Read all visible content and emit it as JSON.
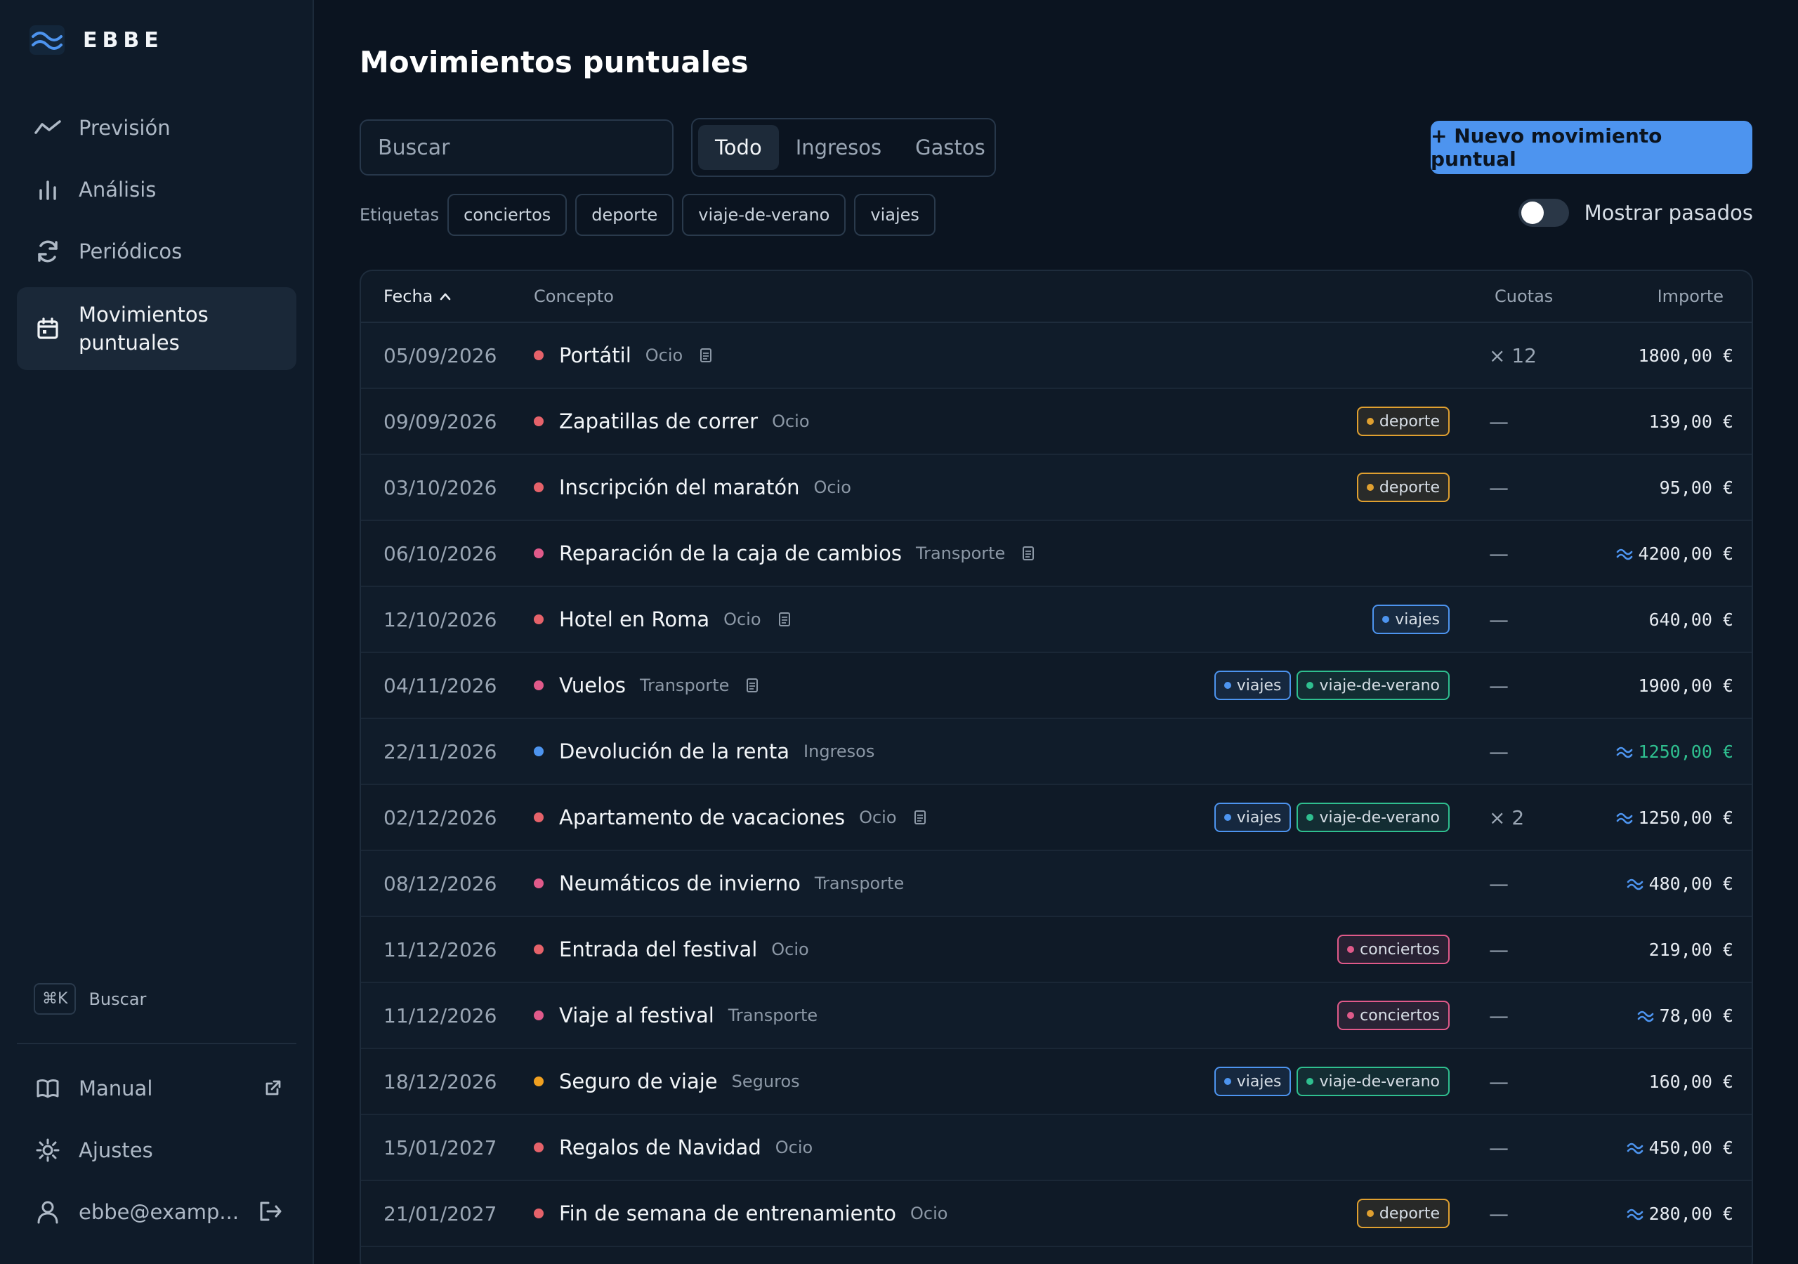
{
  "app": {
    "name": "EBBE"
  },
  "sidebar": {
    "nav": [
      {
        "label": "Previsión",
        "icon": "trend-icon"
      },
      {
        "label": "Análisis",
        "icon": "bar-chart-icon"
      },
      {
        "label": "Periódicos",
        "icon": "refresh-icon"
      },
      {
        "label": "Movimientos puntuales",
        "icon": "calendar-icon",
        "active": true
      }
    ],
    "shortcut": {
      "key": "⌘K",
      "label": "Buscar"
    },
    "bottom": [
      {
        "label": "Manual",
        "icon": "book-icon"
      },
      {
        "label": "Ajustes",
        "icon": "sun-icon"
      },
      {
        "label": "ebbe@examp...",
        "icon": "user-icon"
      }
    ]
  },
  "page": {
    "title": "Movimientos puntuales"
  },
  "toolbar": {
    "search_placeholder": "Buscar",
    "filters": [
      "Todo",
      "Ingresos",
      "Gastos"
    ],
    "active_filter": "Todo",
    "new_button": "+ Nuevo movimiento puntual",
    "tags_label": "Etiquetas",
    "tags": [
      "conciertos",
      "deporte",
      "viaje-de-verano",
      "viajes"
    ],
    "toggle_label": "Mostrar pasados",
    "toggle_on": false
  },
  "colors": {
    "accent": "#4d94ef",
    "expense_dot": "#e5626a",
    "transport_dot": "#e05a8a",
    "income_dot": "#4d94ef",
    "insurance_dot": "#f0a020",
    "income_text": "#2fbf8f",
    "tag_deporte": "#e0a030",
    "tag_viajes": "#4d94ef",
    "tag_viaje_de_verano": "#2fbf8f",
    "tag_conciertos": "#e05a8a"
  },
  "table": {
    "headers": {
      "fecha": "Fecha",
      "concepto": "Concepto",
      "cuotas": "Cuotas",
      "importe": "Importe"
    },
    "rows": [
      {
        "date": "05/09/2026",
        "name": "Portátil",
        "category": "Ocio",
        "dot": "#e5626a",
        "note": true,
        "tags": [],
        "cuotas": "× 12",
        "amount": "1800,00 €",
        "estimated": false,
        "income": false
      },
      {
        "date": "09/09/2026",
        "name": "Zapatillas de correr",
        "category": "Ocio",
        "dot": "#e5626a",
        "note": false,
        "tags": [
          "deporte"
        ],
        "cuotas": "—",
        "amount": "139,00 €",
        "estimated": false,
        "income": false
      },
      {
        "date": "03/10/2026",
        "name": "Inscripción del maratón",
        "category": "Ocio",
        "dot": "#e5626a",
        "note": false,
        "tags": [
          "deporte"
        ],
        "cuotas": "—",
        "amount": "95,00 €",
        "estimated": false,
        "income": false
      },
      {
        "date": "06/10/2026",
        "name": "Reparación de la caja de cambios",
        "category": "Transporte",
        "dot": "#e05a8a",
        "note": true,
        "tags": [],
        "cuotas": "—",
        "amount": "4200,00 €",
        "estimated": true,
        "income": false
      },
      {
        "date": "12/10/2026",
        "name": "Hotel en Roma",
        "category": "Ocio",
        "dot": "#e5626a",
        "note": true,
        "tags": [
          "viajes"
        ],
        "cuotas": "—",
        "amount": "640,00 €",
        "estimated": false,
        "income": false
      },
      {
        "date": "04/11/2026",
        "name": "Vuelos",
        "category": "Transporte",
        "dot": "#e05a8a",
        "note": true,
        "tags": [
          "viajes",
          "viaje-de-verano"
        ],
        "cuotas": "—",
        "amount": "1900,00 €",
        "estimated": false,
        "income": false
      },
      {
        "date": "22/11/2026",
        "name": "Devolución de la renta",
        "category": "Ingresos",
        "dot": "#4d94ef",
        "note": false,
        "tags": [],
        "cuotas": "—",
        "amount": "1250,00 €",
        "estimated": true,
        "income": true
      },
      {
        "date": "02/12/2026",
        "name": "Apartamento de vacaciones",
        "category": "Ocio",
        "dot": "#e5626a",
        "note": true,
        "tags": [
          "viajes",
          "viaje-de-verano"
        ],
        "cuotas": "× 2",
        "amount": "1250,00 €",
        "estimated": true,
        "income": false
      },
      {
        "date": "08/12/2026",
        "name": "Neumáticos de invierno",
        "category": "Transporte",
        "dot": "#e05a8a",
        "note": false,
        "tags": [],
        "cuotas": "—",
        "amount": "480,00 €",
        "estimated": true,
        "income": false
      },
      {
        "date": "11/12/2026",
        "name": "Entrada del festival",
        "category": "Ocio",
        "dot": "#e5626a",
        "note": false,
        "tags": [
          "conciertos"
        ],
        "cuotas": "—",
        "amount": "219,00 €",
        "estimated": false,
        "income": false
      },
      {
        "date": "11/12/2026",
        "name": "Viaje al festival",
        "category": "Transporte",
        "dot": "#e05a8a",
        "note": false,
        "tags": [
          "conciertos"
        ],
        "cuotas": "—",
        "amount": "78,00 €",
        "estimated": true,
        "income": false
      },
      {
        "date": "18/12/2026",
        "name": "Seguro de viaje",
        "category": "Seguros",
        "dot": "#f0a020",
        "note": false,
        "tags": [
          "viajes",
          "viaje-de-verano"
        ],
        "cuotas": "—",
        "amount": "160,00 €",
        "estimated": false,
        "income": false
      },
      {
        "date": "15/01/2027",
        "name": "Regalos de Navidad",
        "category": "Ocio",
        "dot": "#e5626a",
        "note": false,
        "tags": [],
        "cuotas": "—",
        "amount": "450,00 €",
        "estimated": true,
        "income": false
      },
      {
        "date": "21/01/2027",
        "name": "Fin de semana de entrenamiento",
        "category": "Ocio",
        "dot": "#e5626a",
        "note": false,
        "tags": [
          "deporte"
        ],
        "cuotas": "—",
        "amount": "280,00 €",
        "estimated": true,
        "income": false
      }
    ]
  }
}
